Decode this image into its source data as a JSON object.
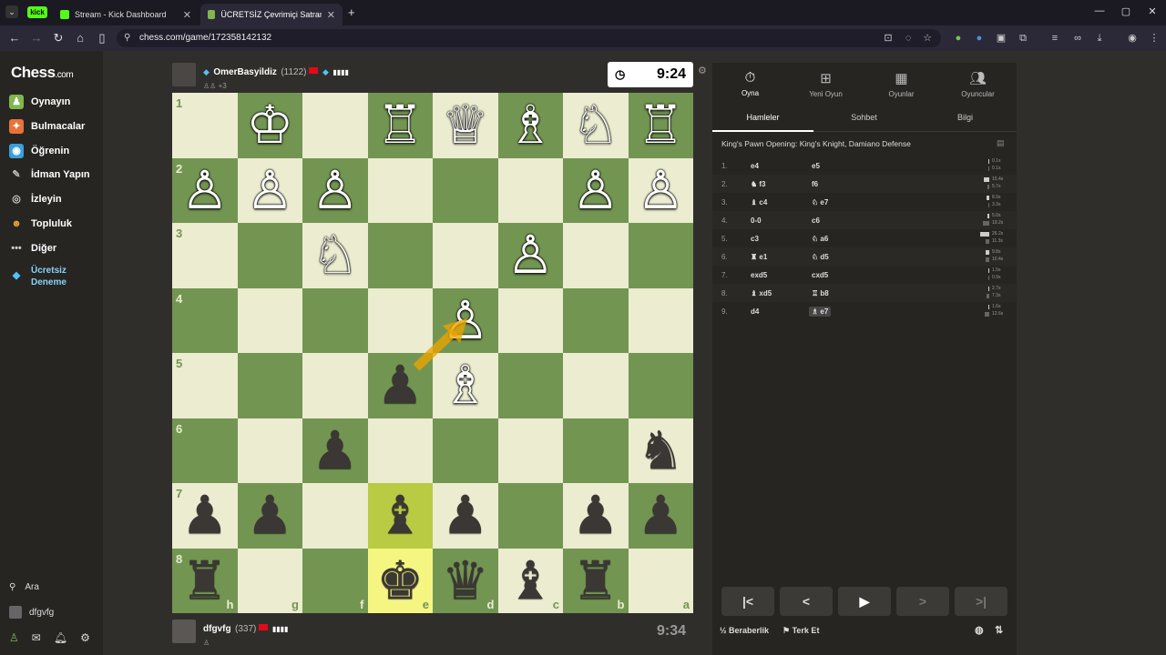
{
  "browser": {
    "tabs": [
      {
        "label": "Stream - Kick Dashboard",
        "icon": "kick-icon"
      },
      {
        "label": "ÜCRETSİZ Çevrimiçi Satranç Oy",
        "icon": "chess-icon"
      }
    ],
    "profile_chip": "kick",
    "url": "chess.com/game/172358142132"
  },
  "sidebar": {
    "logo": "Chess",
    "logo_suffix": ".com",
    "items": [
      {
        "label": "Oynayın",
        "icon": "play-icon"
      },
      {
        "label": "Bulmacalar",
        "icon": "puzzle-icon"
      },
      {
        "label": "Öğrenin",
        "icon": "learn-icon"
      },
      {
        "label": "İdman Yapın",
        "icon": "train-icon"
      },
      {
        "label": "İzleyin",
        "icon": "watch-icon"
      },
      {
        "label": "Topluluk",
        "icon": "community-icon"
      },
      {
        "label": "Diğer",
        "icon": "more-icon"
      },
      {
        "label": "Ücretsiz",
        "icon": "diamond-icon"
      },
      {
        "label": "Deneme",
        "icon": ""
      }
    ],
    "search": "Ara",
    "user": "dfgvfg"
  },
  "top_player": {
    "name": "OmerBasyildiz",
    "rating": "(1122)",
    "extra": "+3",
    "clock": "9:24"
  },
  "bottom_player": {
    "name": "dfgvfg",
    "rating": "(337)",
    "clock": "9:34"
  },
  "board": {
    "ranks": [
      "1",
      "2",
      "3",
      "4",
      "5",
      "6",
      "7",
      "8"
    ],
    "files": [
      "h",
      "g",
      "f",
      "e",
      "d",
      "c",
      "b",
      "a"
    ],
    "rows": [
      [
        "",
        "wK",
        "",
        "wR",
        "wQ",
        "wB",
        "wN",
        "wR"
      ],
      [
        "wP",
        "wP",
        "wP",
        "",
        "",
        "",
        "wP",
        "wP"
      ],
      [
        "",
        "",
        "wN",
        "",
        "",
        "wP",
        "",
        ""
      ],
      [
        "",
        "",
        "",
        "",
        "wP",
        "",
        "",
        ""
      ],
      [
        "",
        "",
        "",
        "bP",
        "wB",
        "",
        "",
        ""
      ],
      [
        "",
        "",
        "bP",
        "",
        "",
        "",
        "",
        "bN"
      ],
      [
        "bP",
        "bP",
        "",
        "bB",
        "bP",
        "",
        "bP",
        "bP"
      ],
      [
        "bR",
        "",
        "",
        "bK",
        "bQ",
        "bB",
        "bR",
        ""
      ]
    ],
    "highlight": [
      "7-3",
      "8-3"
    ]
  },
  "panel": {
    "tabs": [
      "Oyna",
      "Yeni Oyun",
      "Oyunlar",
      "Oyuncular"
    ],
    "subtabs": [
      "Hamleler",
      "Sohbet",
      "Bilgi"
    ],
    "opening": "King's Pawn Opening: King's Knight, Damiano Defense",
    "moves": [
      {
        "n": "1.",
        "w": "e4",
        "b": "e5",
        "tw": "0.1s",
        "tb": "0.1s"
      },
      {
        "n": "2.",
        "w": "♞ f3",
        "b": "f6",
        "tw": "15.4s",
        "tb": "5.7s"
      },
      {
        "n": "3.",
        "w": "♝ c4",
        "b": "♘ e7",
        "tw": "8.9s",
        "tb": "3.3s"
      },
      {
        "n": "4.",
        "w": "0-0",
        "b": "c6",
        "tw": "5.0s",
        "tb": "19.2s"
      },
      {
        "n": "5.",
        "w": "c3",
        "b": "♘ a6",
        "tw": "26.2s",
        "tb": "11.3s"
      },
      {
        "n": "6.",
        "w": "♜ e1",
        "b": "♘ d5",
        "tw": "9.8s",
        "tb": "10.4s"
      },
      {
        "n": "7.",
        "w": "exd5",
        "b": "cxd5",
        "tw": "1.5s",
        "tb": "0.9s"
      },
      {
        "n": "8.",
        "w": "♝ xd5",
        "b": "♖ b8",
        "tw": "2.7s",
        "tb": "7.3s"
      },
      {
        "n": "9.",
        "w": "d4",
        "b": "♗ e7",
        "tw": "1.6s",
        "tb": "12.6s"
      }
    ],
    "draw": "Beraberlik",
    "draw_prefix": "½",
    "resign": "Terk Et"
  }
}
